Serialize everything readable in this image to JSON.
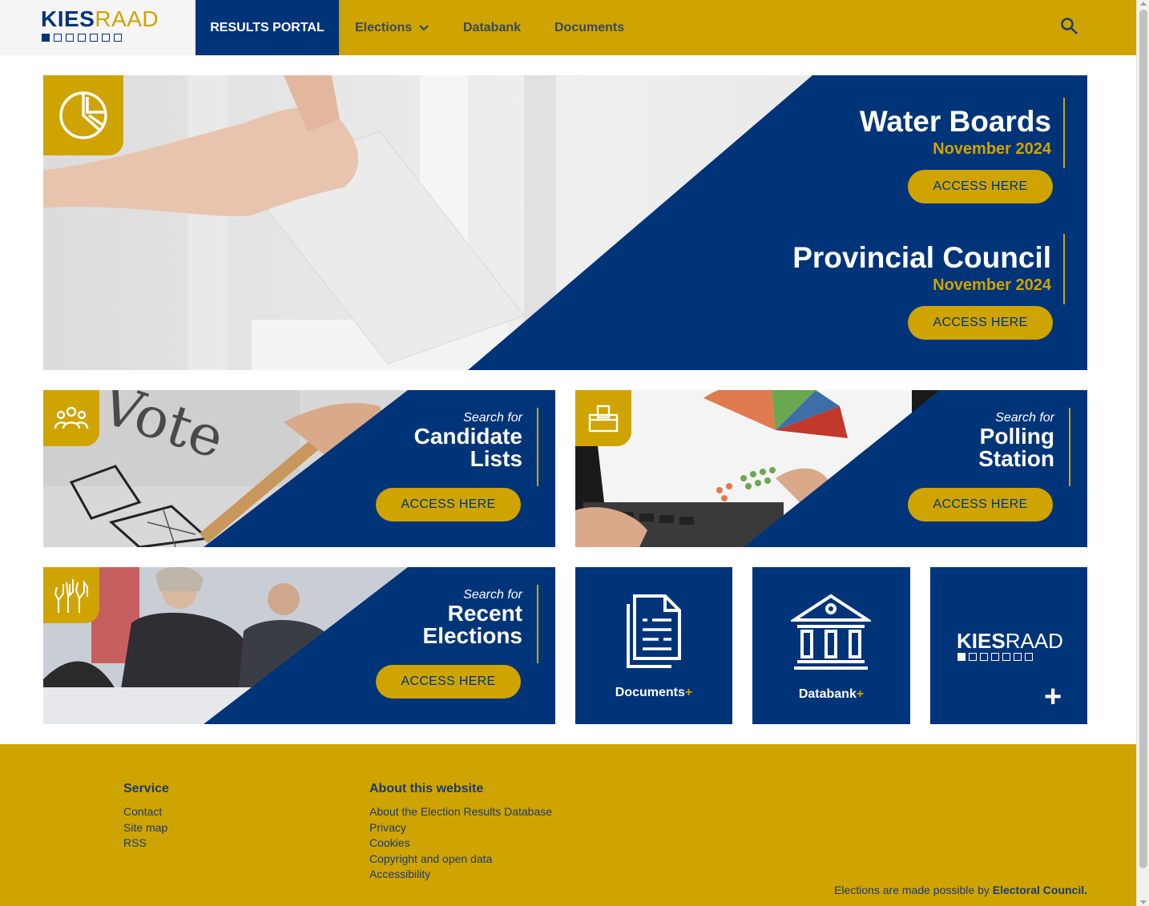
{
  "header": {
    "logo": {
      "kies": "KIES",
      "raad": "RAAD"
    },
    "nav": {
      "results_portal": "RESULTS PORTAL",
      "elections": "Elections",
      "databank": "Databank",
      "documents": "Documents"
    },
    "search_icon": "search-icon"
  },
  "hero": {
    "icon": "pie-chart-icon",
    "items": [
      {
        "title": "Water Boards",
        "date": "November 2024",
        "button": "ACCESS HERE"
      },
      {
        "title": "Provincial Council",
        "date": "November 2024",
        "button": "ACCESS HERE"
      }
    ]
  },
  "cards": {
    "candidate": {
      "prefix": "Search for",
      "title_line1": "Candidate",
      "title_line2": "Lists",
      "button": "ACCESS HERE",
      "icon": "people-icon"
    },
    "polling": {
      "prefix": "Search for",
      "title_line1": "Polling",
      "title_line2": "Station",
      "button": "ACCESS HERE",
      "icon": "ballot-box-icon"
    },
    "recent": {
      "prefix": "Search for",
      "title_line1": "Recent",
      "title_line2": "Elections",
      "button": "ACCESS HERE",
      "icon": "raised-hands-icon"
    }
  },
  "tiles": {
    "documents": {
      "label": "Documents",
      "plus": "+"
    },
    "databank": {
      "label": "Databank",
      "plus": "+"
    },
    "kiesraad": {
      "kies": "KIES",
      "raad": "RAAD",
      "plus": "+"
    }
  },
  "footer": {
    "service": {
      "heading": "Service",
      "links": [
        "Contact",
        "Site map",
        "RSS"
      ]
    },
    "about": {
      "heading": "About this website",
      "links": [
        "About the Election Results Database",
        "Privacy",
        "Cookies",
        "Copyright and open data",
        "Accessibility"
      ]
    },
    "credit_prefix": "Elections are made possible by",
    "credit_org": "Electoral Council."
  },
  "colors": {
    "gold": "#cfa300",
    "navy": "#003479"
  }
}
